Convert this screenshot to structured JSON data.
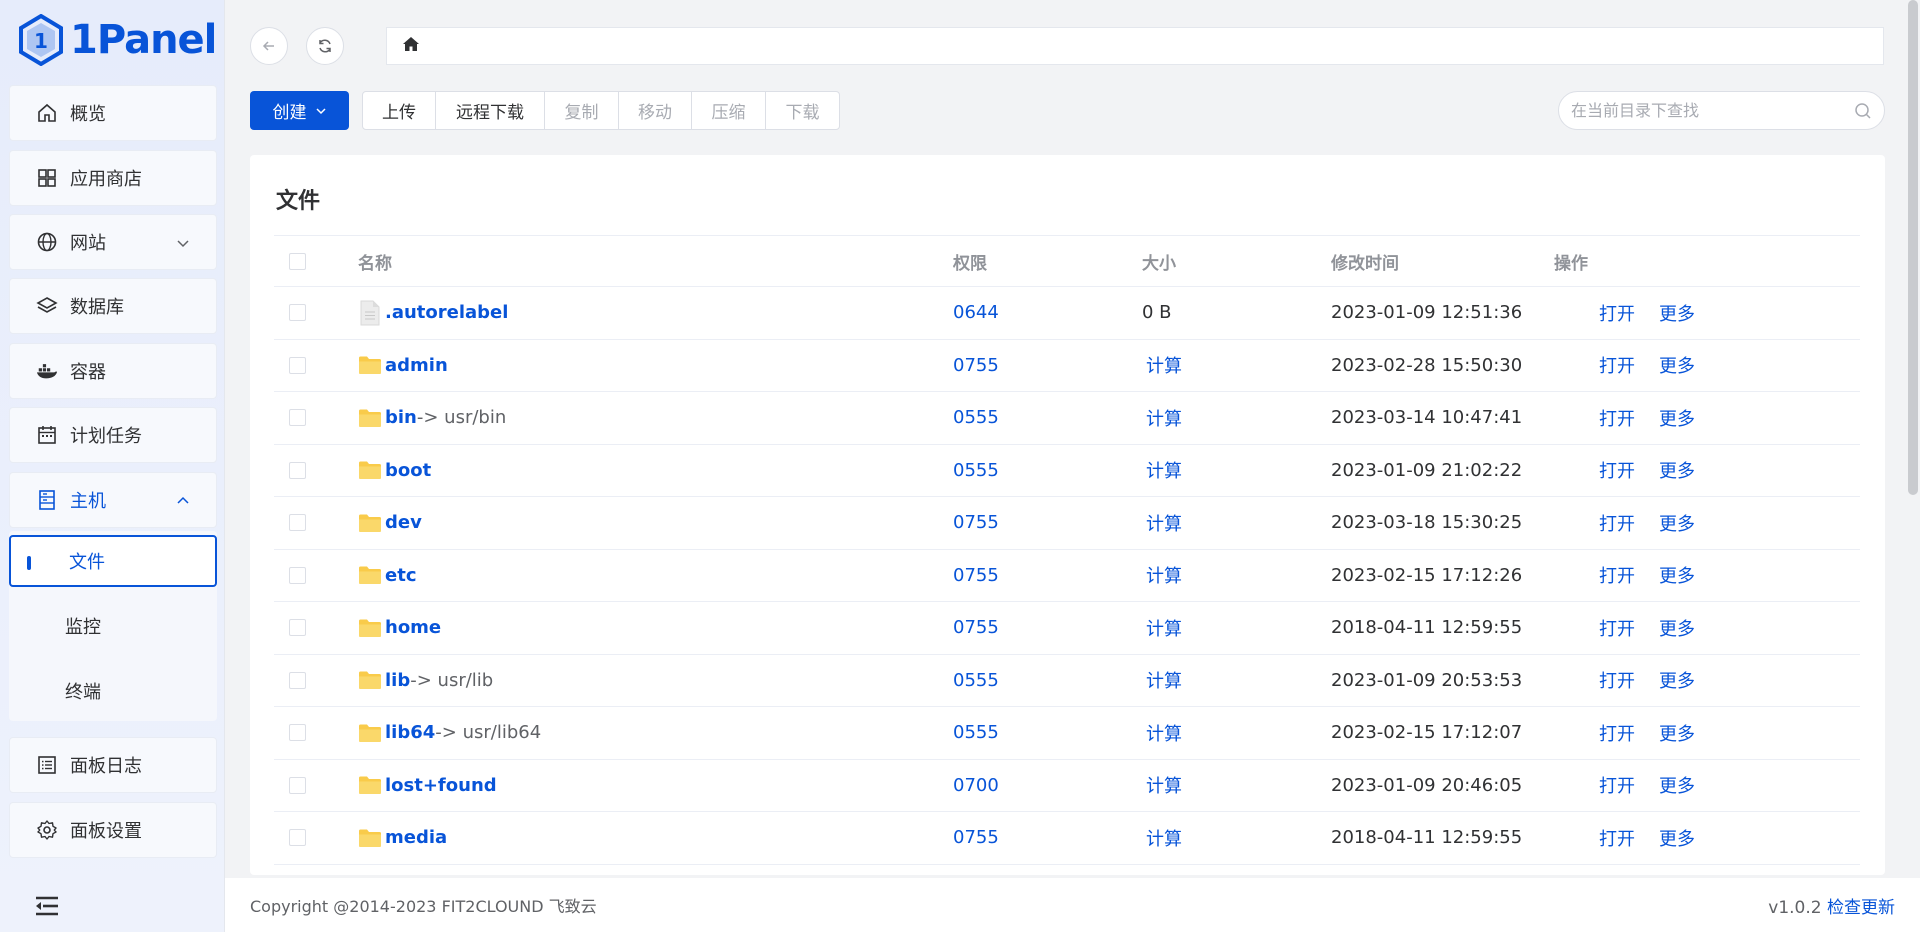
{
  "app": {
    "logo_text": "1Panel",
    "brand_color": "#0854d8"
  },
  "sidebar": {
    "items": [
      {
        "label": "概览",
        "icon": "home-icon"
      },
      {
        "label": "应用商店",
        "icon": "grid-icon"
      },
      {
        "label": "网站",
        "icon": "globe-icon"
      },
      {
        "label": "数据库",
        "icon": "layers-icon"
      },
      {
        "label": "容器",
        "icon": "docker-icon"
      },
      {
        "label": "计划任务",
        "icon": "calendar-icon"
      },
      {
        "label": "主机",
        "icon": "server-icon"
      },
      {
        "label": "面板日志",
        "icon": "log-icon"
      },
      {
        "label": "面板设置",
        "icon": "gear-icon"
      }
    ],
    "host_sub": [
      {
        "label": "文件",
        "active": true
      },
      {
        "label": "监控"
      },
      {
        "label": "终端"
      }
    ]
  },
  "toolbar": {
    "create_label": "创建",
    "buttons": [
      {
        "label": "上传",
        "disabled": false
      },
      {
        "label": "远程下载",
        "disabled": false
      },
      {
        "label": "复制",
        "disabled": true
      },
      {
        "label": "移动",
        "disabled": true
      },
      {
        "label": "压缩",
        "disabled": true
      },
      {
        "label": "下载",
        "disabled": true
      }
    ],
    "search_placeholder": "在当前目录下查找"
  },
  "main": {
    "title": "文件",
    "columns": {
      "name": "名称",
      "perm": "权限",
      "size": "大小",
      "mtime": "修改时间",
      "ops": "操作"
    },
    "open_label": "打开",
    "more_label": "更多",
    "rows": [
      {
        "name": ".autorelabel",
        "type": "file",
        "link": "",
        "perm": "0644",
        "size": "0 B",
        "mtime": "2023-01-09 12:51:36"
      },
      {
        "name": "admin",
        "type": "folder",
        "link": "",
        "perm": "0755",
        "size": "计算",
        "mtime": "2023-02-28 15:50:30"
      },
      {
        "name": "bin",
        "type": "folder",
        "link": "-> usr/bin",
        "perm": "0555",
        "size": "计算",
        "mtime": "2023-03-14 10:47:41"
      },
      {
        "name": "boot",
        "type": "folder",
        "link": "",
        "perm": "0555",
        "size": "计算",
        "mtime": "2023-01-09 21:02:22"
      },
      {
        "name": "dev",
        "type": "folder",
        "link": "",
        "perm": "0755",
        "size": "计算",
        "mtime": "2023-03-18 15:30:25"
      },
      {
        "name": "etc",
        "type": "folder",
        "link": "",
        "perm": "0755",
        "size": "计算",
        "mtime": "2023-02-15 17:12:26"
      },
      {
        "name": "home",
        "type": "folder",
        "link": "",
        "perm": "0755",
        "size": "计算",
        "mtime": "2018-04-11 12:59:55"
      },
      {
        "name": "lib",
        "type": "folder",
        "link": "-> usr/lib",
        "perm": "0555",
        "size": "计算",
        "mtime": "2023-01-09 20:53:53"
      },
      {
        "name": "lib64",
        "type": "folder",
        "link": "-> usr/lib64",
        "perm": "0555",
        "size": "计算",
        "mtime": "2023-02-15 17:12:07"
      },
      {
        "name": "lost+found",
        "type": "folder",
        "link": "",
        "perm": "0700",
        "size": "计算",
        "mtime": "2023-01-09 20:46:05"
      },
      {
        "name": "media",
        "type": "folder",
        "link": "",
        "perm": "0755",
        "size": "计算",
        "mtime": "2018-04-11 12:59:55"
      }
    ]
  },
  "footer": {
    "copyright": "Copyright @2014-2023 FIT2CLOUND 飞致云",
    "version": "v1.0.2",
    "check_update": "检查更新"
  }
}
